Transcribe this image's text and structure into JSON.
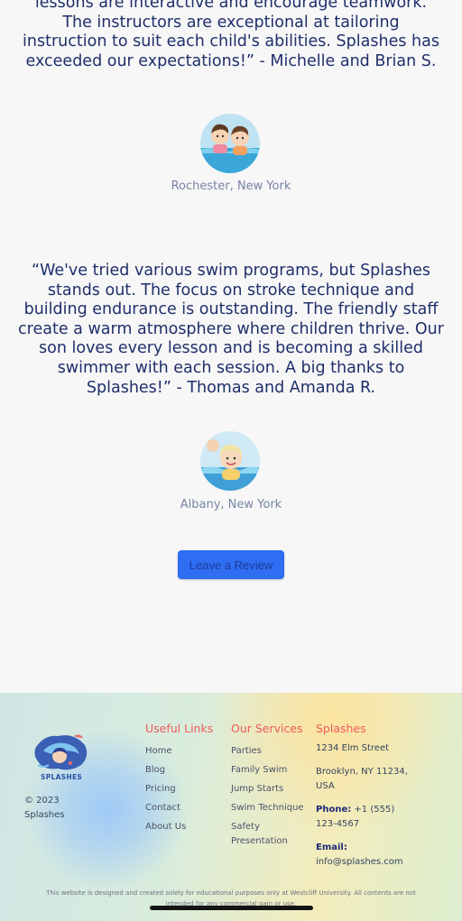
{
  "testimonials": [
    {
      "quote": "lessons are interactive and encourage teamwork. The instructors are exceptional at tailoring instruction to suit each child's abilities. Splashes has exceeded our expectations!” - Michelle and Brian S.",
      "location": "Rochester, New York"
    },
    {
      "quote": "“We've tried various swim programs, but Splashes stands out. The focus on stroke technique and building endurance is outstanding. The friendly staff create a warm atmosphere where children thrive. Our son loves every lesson and is becoming a skilled swimmer with each session. A big thanks to Splashes!” - Thomas and Amanda R.",
      "location": "Albany, New York"
    }
  ],
  "review_button": "Leave a Review",
  "footer": {
    "logo_text": "SPLASHES",
    "copyright": "© 2023 Splashes",
    "useful_links": {
      "heading": "Useful Links",
      "items": [
        "Home",
        "Blog",
        "Pricing",
        "Contact",
        "About Us"
      ]
    },
    "services": {
      "heading": "Our Services",
      "items": [
        "Parties",
        "Family Swim",
        "Jump Starts",
        "Swim Technique",
        "Safety Presentation"
      ]
    },
    "contact": {
      "heading": "Splashes",
      "address_line1": "1234 Elm Street",
      "address_line2": "Brooklyn, NY 11234, USA",
      "phone_label": "Phone:",
      "phone": "+1 (555) 123-4567",
      "email_label": "Email:",
      "email": "info@splashes.com"
    },
    "disclaimer": "This website is designed and created solely for educational purposes only at Westcliff University. All contents are not intended for any commercial gain or use."
  },
  "colors": {
    "text_navy": "#1f2f6b",
    "heading_red": "#ef5b5b",
    "button_blue": "#2f6df2"
  }
}
